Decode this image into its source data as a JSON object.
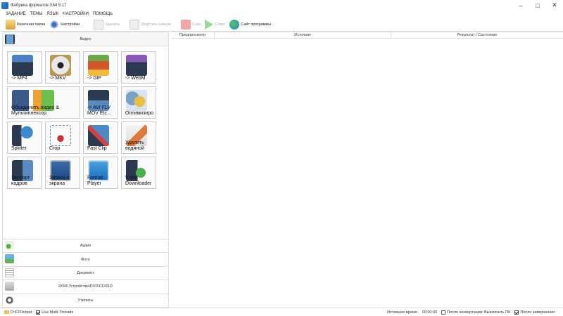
{
  "window": {
    "title": "Фабрика форматов X64 5.17"
  },
  "menu": [
    "ЗАДАНИЕ",
    "ТЕМЫ",
    "ЯЗЫК",
    "НАСТРОЙКИ",
    "ПОМОЩЬ"
  ],
  "toolbar": {
    "output_folder": "Конечная папка",
    "settings": "Настройки",
    "delete": "Удалить",
    "clear_list": "Очистить список",
    "stop": "Стоп",
    "start": "Старт",
    "website": "Сайт программы"
  },
  "left_panel": {
    "video_header": "Видео",
    "tiles": [
      {
        "label": "-> MP4",
        "icon": "mp4-icon"
      },
      {
        "label": "-> MKV",
        "icon": "mkv-icon"
      },
      {
        "label": "-> GIF",
        "icon": "gif-icon"
      },
      {
        "label": "-> WebM",
        "icon": "webm-icon"
      },
      {
        "label": "Объединить видео &\nМультиплексор",
        "icon": "merge-icon"
      },
      {
        "label": "-> AVI FLV\nMOV Etc...",
        "icon": "avi-flv-icon"
      },
      {
        "label": "Оптимизиро",
        "icon": "optimize-icon"
      },
      {
        "label": "Splitter",
        "icon": "splitter-icon"
      },
      {
        "label": "Crop",
        "icon": "crop-icon"
      },
      {
        "label": "Fast Clip",
        "icon": "fastclip-icon"
      },
      {
        "label": "Удалить\nводяной",
        "icon": "remove-watermark-icon"
      },
      {
        "label": "Экспорт\nкадров",
        "icon": "export-frames-icon"
      },
      {
        "label": "Запись с\nэкрана",
        "icon": "screen-record-icon"
      },
      {
        "label": "Format\nPlayer",
        "icon": "format-player-icon"
      },
      {
        "label": "Video\nDownloader",
        "icon": "video-downloader-icon"
      }
    ],
    "categories": [
      {
        "label": "Аудио",
        "icon": "audio-icon"
      },
      {
        "label": "Фото",
        "icon": "photo-icon"
      },
      {
        "label": "Документ",
        "icon": "document-icon"
      },
      {
        "label": "ROM Устройство\\DVD\\CD\\ISO",
        "icon": "rom-icon"
      },
      {
        "label": "Утилиты",
        "icon": "utilities-icon"
      }
    ]
  },
  "table": {
    "columns": [
      "Предпросмотр",
      "Источник",
      "Результат / Состояние"
    ]
  },
  "statusbar": {
    "folder_path": "D:\\FFOutput",
    "multi_threads": "Use Multi-Threads",
    "elapsed_label": "Истекшее время :",
    "elapsed_value": "00:00:00",
    "after_convert": "После конвертации: Выключить ПК",
    "after_finish": "После завершения"
  },
  "colors": {
    "accent": "#1f7fd0",
    "stop": "#f4a6a6",
    "start": "#98d898"
  }
}
